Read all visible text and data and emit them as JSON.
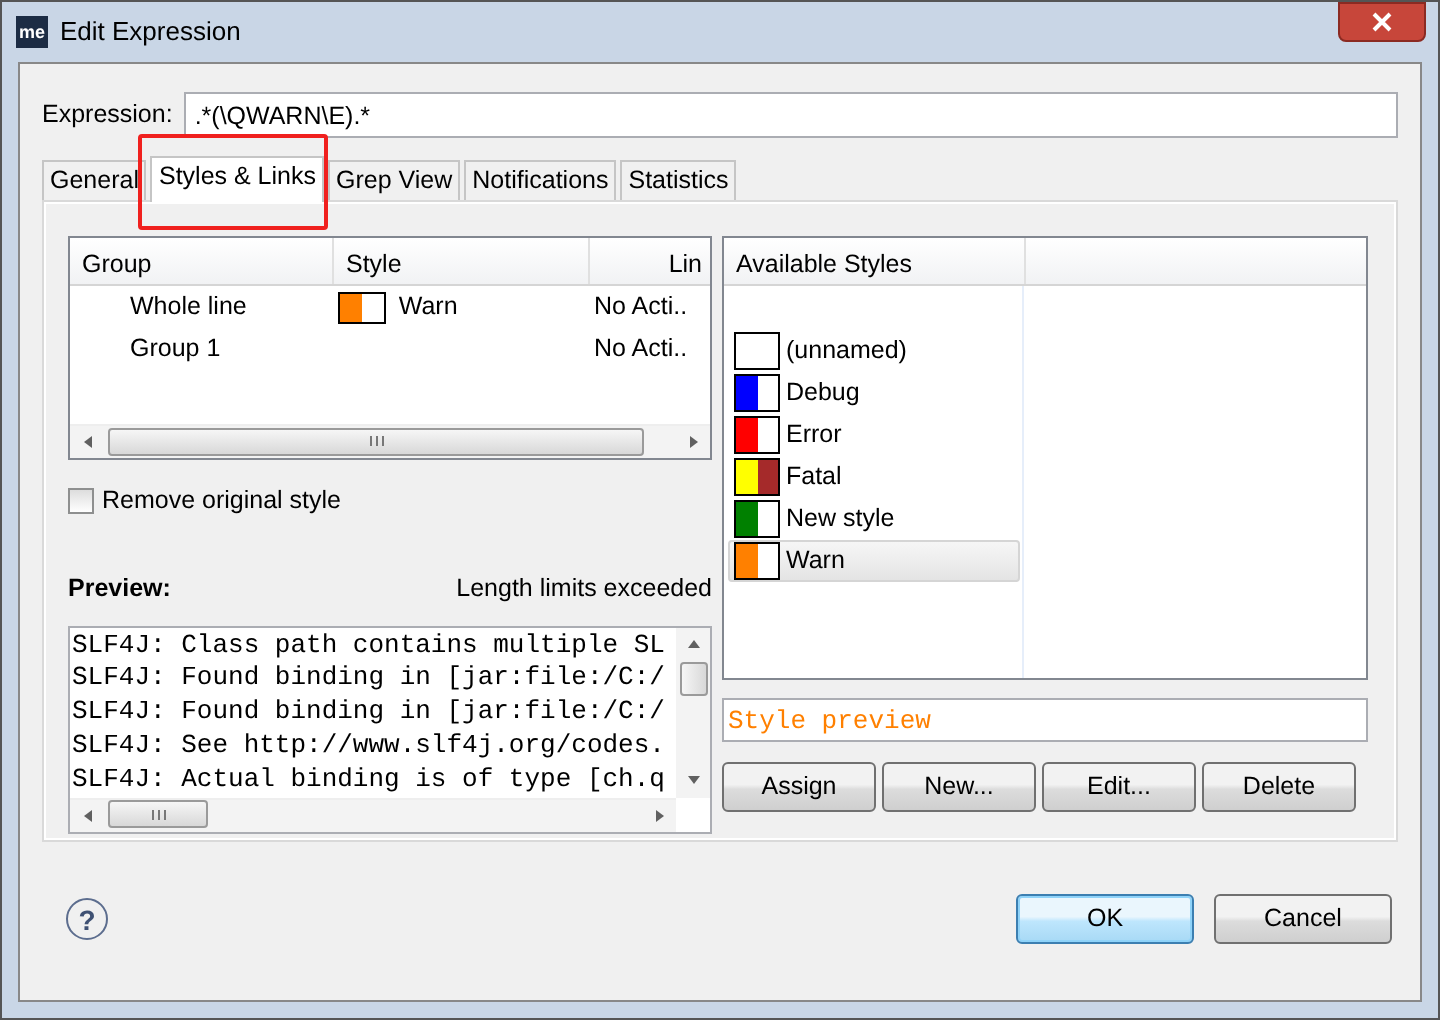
{
  "window": {
    "title": "Edit Expression",
    "app_icon": "me"
  },
  "expression": {
    "label": "Expression:",
    "value": ".*(\\QWARN\\E).*"
  },
  "tabs": [
    {
      "label": "General",
      "selected": false
    },
    {
      "label": "Styles & Links",
      "selected": true,
      "highlighted": true
    },
    {
      "label": "Grep View",
      "selected": false
    },
    {
      "label": "Notifications",
      "selected": false
    },
    {
      "label": "Statistics",
      "selected": false
    }
  ],
  "groups_table": {
    "columns": [
      "Group",
      "Style",
      "Lin"
    ],
    "rows": [
      {
        "group": "Whole line",
        "style": {
          "name": "Warn",
          "swatch": [
            {
              "color": "#ff8000"
            },
            {
              "color": "#ffffff"
            }
          ]
        },
        "column_3": "No Acti.."
      },
      {
        "group": "Group 1",
        "column_3": "No Acti.."
      }
    ]
  },
  "remove_original_style": {
    "label": "Remove original style",
    "checked": false
  },
  "preview": {
    "label": "Preview:",
    "status": "Length limits exceeded",
    "lines": [
      "SLF4J: Class path contains multiple SL",
      "SLF4J: Found binding in [jar:file:/C:/",
      "SLF4J: Found binding in [jar:file:/C:/",
      "SLF4J: See http://www.slf4j.org/codes.",
      "SLF4J: Actual binding is of type [ch.q"
    ]
  },
  "available_styles": {
    "columns": [
      "Available Styles"
    ],
    "items": [
      {
        "name": "(unnamed)",
        "swatch": [
          {
            "color": "#ffffff"
          },
          {
            "color": "#ffffff"
          }
        ],
        "selected": false
      },
      {
        "name": "Debug",
        "swatch": [
          {
            "color": "#0000ff"
          },
          {
            "color": "#ffffff"
          }
        ],
        "selected": false
      },
      {
        "name": "Error",
        "swatch": [
          {
            "color": "#ff0000"
          },
          {
            "color": "#ffffff"
          }
        ],
        "selected": false
      },
      {
        "name": "Fatal",
        "swatch": [
          {
            "color": "#ffff00"
          },
          {
            "color": "#a52a2a"
          }
        ],
        "selected": false
      },
      {
        "name": "New style",
        "swatch": [
          {
            "color": "#008000"
          },
          {
            "color": "#ffffff"
          }
        ],
        "selected": false
      },
      {
        "name": "Warn",
        "swatch": [
          {
            "color": "#ff8000"
          },
          {
            "color": "#ffffff"
          }
        ],
        "selected": true
      }
    ]
  },
  "style_preview": {
    "text": "Style preview",
    "color": "#ff8000"
  },
  "style_buttons": [
    "Assign",
    "New...",
    "Edit...",
    "Delete"
  ],
  "help_button": {
    "label": "?"
  },
  "footer_buttons": [
    {
      "label": "OK",
      "default": true
    },
    {
      "label": "Cancel",
      "default": false
    }
  ]
}
